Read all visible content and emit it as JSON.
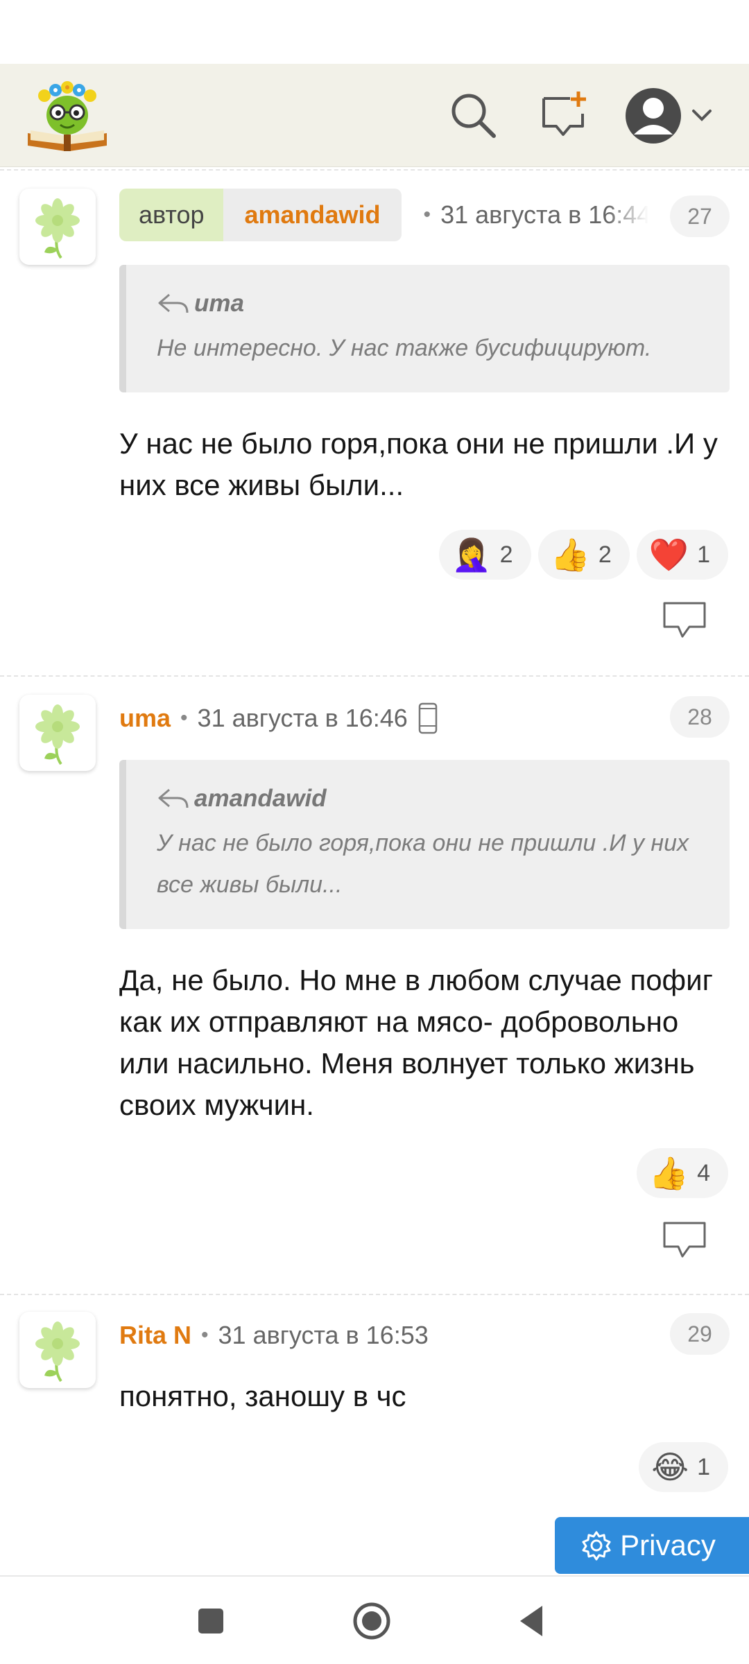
{
  "comments": [
    {
      "author_tag": "автор",
      "username": "amandawid",
      "timestamp": "31 августа в 16:44",
      "number": "27",
      "quote": {
        "author": "uma",
        "text": "Не интересно. У нас также бусифицируют."
      },
      "text": "У нас не было горя,пока они не пришли .И у них все живы были...",
      "reactions": [
        {
          "emoji": "🤦‍♀️",
          "count": "2"
        },
        {
          "emoji": "👍",
          "count": "2"
        },
        {
          "emoji": "❤️",
          "count": "1"
        }
      ]
    },
    {
      "username": "uma",
      "timestamp": "31 августа в 16:46",
      "number": "28",
      "quote": {
        "author": "amandawid",
        "text": "У нас не было горя,пока они не пришли .И у них все живы были..."
      },
      "text": "Да, не было. Но мне в любом случае пофиг как их отправляют на мясо- добровольно или насильно. Меня волнует только жизнь своих мужчин.",
      "reactions": [
        {
          "emoji": "👍",
          "count": "4"
        }
      ]
    },
    {
      "username": "Rita N",
      "timestamp": "31 августа в 16:53",
      "number": "29",
      "text": "понятно, заношу в чс",
      "reactions": [
        {
          "emoji": "😂",
          "count": "1"
        }
      ]
    }
  ],
  "privacy_button": {
    "label": "Privacy"
  },
  "colors": {
    "accent_orange": "#e07a10",
    "header_bg": "#f2f1e8",
    "author_tag_bg": "#dfeec2",
    "privacy_blue": "#2f8cdc"
  },
  "icons": {
    "search": "search-icon",
    "new_topic": "new-topic-icon",
    "account": "account-icon",
    "reply": "reply-icon",
    "quote_reply": "reply-arrow-icon",
    "device": "mobile-device-icon",
    "settings": "gear-icon"
  }
}
